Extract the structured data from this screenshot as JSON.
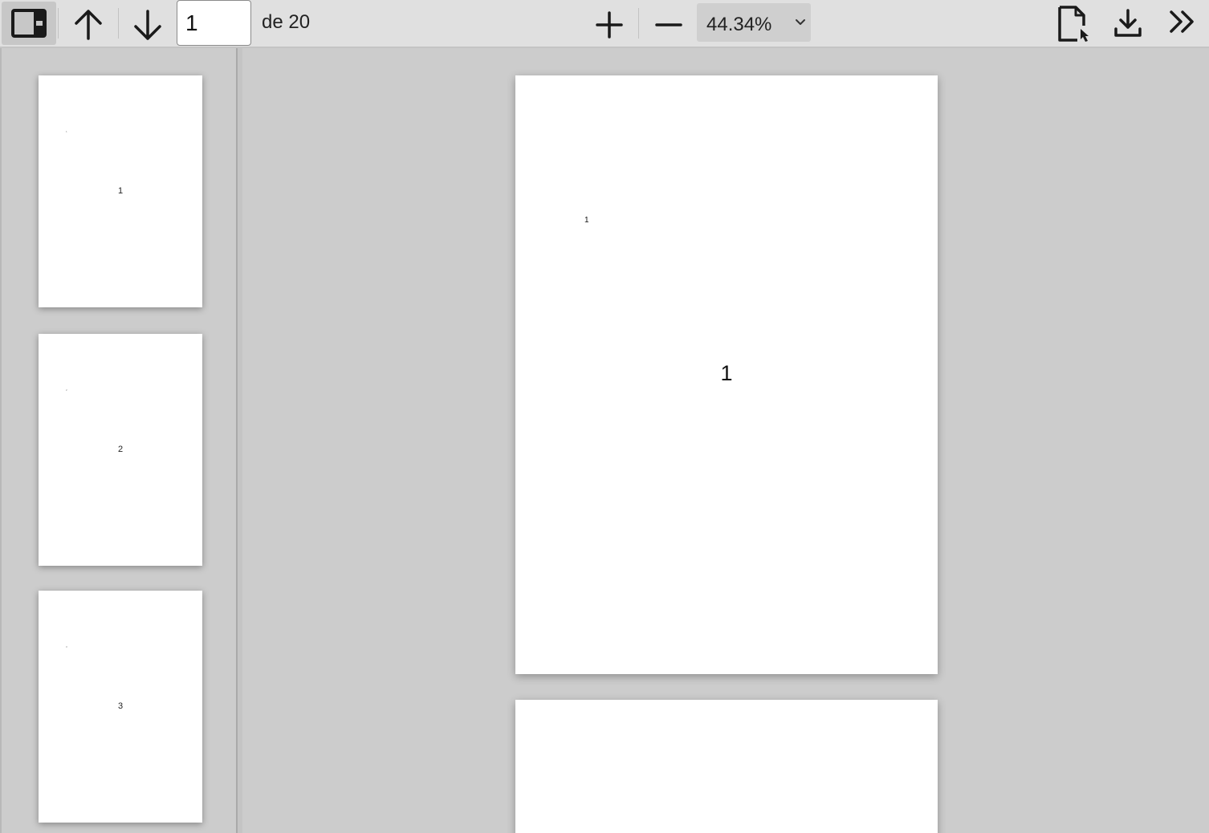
{
  "toolbar": {
    "sidebar_toggle_icon": "sidebar-toggle-icon",
    "prev_icon": "arrow-up-icon",
    "next_icon": "arrow-down-icon",
    "page_number": "1",
    "page_count": "de 20",
    "zoom_in_icon": "plus-icon",
    "zoom_out_icon": "minus-icon",
    "zoom_value": "44.34%",
    "present_icon": "document-cursor-icon",
    "download_icon": "download-icon",
    "more_icon": "double-chevron-right-icon"
  },
  "thumbnails": [
    {
      "mark": "1",
      "number": "1"
    },
    {
      "mark": "2",
      "number": "2"
    },
    {
      "mark": "3",
      "number": "3"
    }
  ],
  "pages": [
    {
      "small_label": "1",
      "big_label": "1"
    },
    {
      "small_label": "",
      "big_label": ""
    }
  ]
}
